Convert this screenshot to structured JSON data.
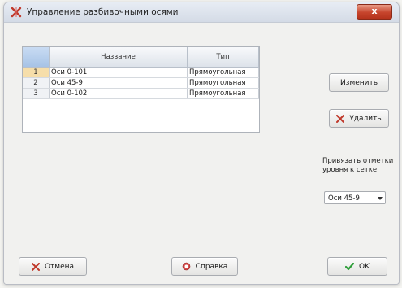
{
  "window": {
    "title": "Управление разбивочными осями",
    "close_label": "x"
  },
  "grid": {
    "columns": [
      "",
      "Название",
      "Тип"
    ],
    "rows": [
      {
        "num": "1",
        "name": "Оси 0-101",
        "type": "Прямоугольная"
      },
      {
        "num": "2",
        "name": "Оси 45-9",
        "type": "Прямоугольная"
      },
      {
        "num": "3",
        "name": "Оси 0-102",
        "type": "Прямоугольная"
      }
    ]
  },
  "actions": {
    "edit": "Изменить",
    "delete": "Удалить"
  },
  "binding": {
    "label_line1": "Привязать отметки",
    "label_line2": "уровня к сетке",
    "selected": "Оси 45-9"
  },
  "footer": {
    "cancel": "Отмена",
    "help": "Справка",
    "ok": "OK"
  },
  "colors": {
    "title_icon": "#c0392b",
    "delete_icon": "#c0392b",
    "ok_icon": "#2e9e3a",
    "selected_row": "#f6deaa"
  }
}
